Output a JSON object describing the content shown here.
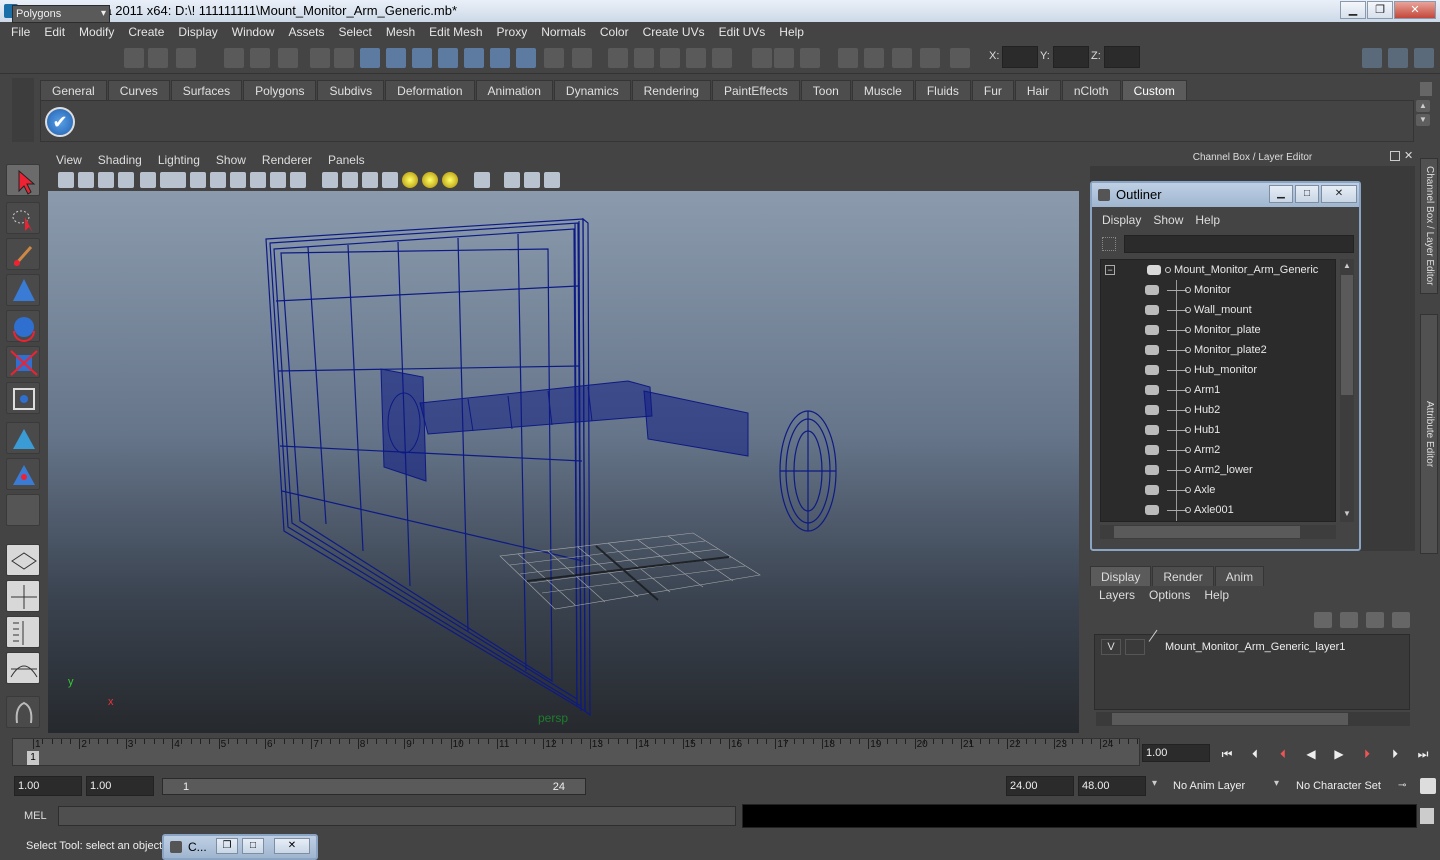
{
  "window": {
    "title": "Autodesk Maya 2011 x64: D:\\! 111111111\\Mount_Monitor_Arm_Generic.mb*"
  },
  "menubar": [
    "File",
    "Edit",
    "Modify",
    "Create",
    "Display",
    "Window",
    "Assets",
    "Select",
    "Mesh",
    "Edit Mesh",
    "Proxy",
    "Normals",
    "Color",
    "Create UVs",
    "Edit UVs",
    "Help"
  ],
  "statusline": {
    "mode": "Polygons",
    "x_label": "X:",
    "y_label": "Y:",
    "z_label": "Z:"
  },
  "shelf": {
    "tabs": [
      "General",
      "Curves",
      "Surfaces",
      "Polygons",
      "Subdivs",
      "Deformation",
      "Animation",
      "Dynamics",
      "Rendering",
      "PaintEffects",
      "Toon",
      "Muscle",
      "Fluids",
      "Fur",
      "Hair",
      "nCloth",
      "Custom"
    ],
    "active": "Custom"
  },
  "viewport": {
    "menus": [
      "View",
      "Shading",
      "Lighting",
      "Show",
      "Renderer",
      "Panels"
    ],
    "camera": "persp",
    "axis_x": "x",
    "axis_y": "y"
  },
  "channel_box": {
    "title": "Channel Box / Layer Editor"
  },
  "side_tabs": [
    "Channel Box / Layer Editor",
    "Attribute Editor"
  ],
  "outliner": {
    "title": "Outliner",
    "menus": [
      "Display",
      "Show",
      "Help"
    ],
    "root": "Mount_Monitor_Arm_Generic",
    "items": [
      "Monitor",
      "Wall_mount",
      "Monitor_plate",
      "Monitor_plate2",
      "Hub_monitor",
      "Arm1",
      "Hub2",
      "Hub1",
      "Arm2",
      "Arm2_lower",
      "Axle",
      "Axle001"
    ]
  },
  "layer_editor": {
    "tabs": [
      "Display",
      "Render",
      "Anim"
    ],
    "active": "Display",
    "menus": [
      "Layers",
      "Options",
      "Help"
    ],
    "layer": {
      "visible": "V",
      "name": "Mount_Monitor_Arm_Generic_layer1"
    }
  },
  "timeslider": {
    "ticks": [
      "1",
      "2",
      "3",
      "4",
      "5",
      "6",
      "7",
      "8",
      "9",
      "10",
      "11",
      "12",
      "13",
      "14",
      "15",
      "16",
      "17",
      "18",
      "19",
      "20",
      "21",
      "22",
      "23",
      "24"
    ],
    "current_marker": "1",
    "current_frame": "1.00"
  },
  "range": {
    "start": "1.00",
    "anim_start": "1.00",
    "range_start": "1",
    "range_end": "24",
    "end": "24.00",
    "anim_end": "48.00",
    "anim_layer": "No Anim Layer",
    "character_set": "No Character Set"
  },
  "commandline": {
    "label": "MEL"
  },
  "helpline": {
    "text": "Select Tool: select an object",
    "minimized": "C..."
  }
}
